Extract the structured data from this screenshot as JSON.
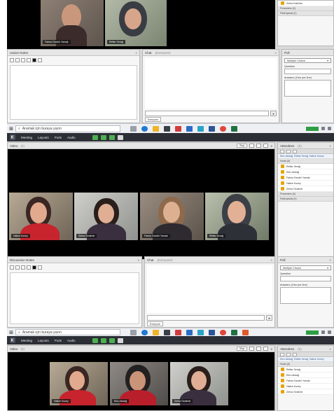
{
  "taskbar": {
    "search_placeholder": "Aramak için buraya yazın"
  },
  "menu": {
    "items": [
      "Meeting",
      "Layouts",
      "Pods",
      "Audio"
    ]
  },
  "panes": {
    "video_title": "Video",
    "video_count": "(4)",
    "stop_btn": "Stop",
    "notes_title": "Discussion Notes",
    "notes_title_partial": "ussion Notes",
    "chat_title": "Chat",
    "chat_sub": "(Everyone)",
    "chat_tab": "Everyone",
    "poll_title": "Poll",
    "poll_type": "Multiple Choice",
    "poll_question": "Question",
    "poll_answers": "Answers (One per line)",
    "att_title": "Attendees",
    "att_count": "(6)"
  },
  "shot1": {
    "participants": [
      "Fatma Gezdiri Yamak",
      "Reftar Serağ"
    ],
    "att_partial_rows": [
      "Zehra Karlıhan",
      "Presenters (0)",
      "Participants (0)"
    ]
  },
  "shot2": {
    "participants": [
      "Hatice Kozey",
      "Zehra Özdemir",
      "Fatma Gezdiri Yamak",
      "Reftar Serağ"
    ],
    "selected": "Ebru Akdağ, Reftar Serağ, Hatice Kozey",
    "hosts_label": "Hosts (6)",
    "hosts": [
      "Reftar Serağ",
      "Ebru Akdağ",
      "Fatma Gezdiri Yamak",
      "Hatice Kozey",
      "Zehra Özdemir"
    ],
    "presenters_label": "Presenters (0)",
    "participants_label": "Participants (0)"
  },
  "shot3": {
    "participants": [
      "Hatice Kozey",
      "Ebru Akdağ",
      "Zehra Özdemir"
    ],
    "selected": "Ebru Akdağ, Reftar Serağ, Hatice Kozey",
    "hosts_label": "Hosts (6)",
    "hosts": [
      "Reftar Serağ",
      "Ebru Akdağ",
      "Fatma Gezdiri Yamak",
      "Hatice Kozey",
      "Zehra Özdemir"
    ]
  }
}
